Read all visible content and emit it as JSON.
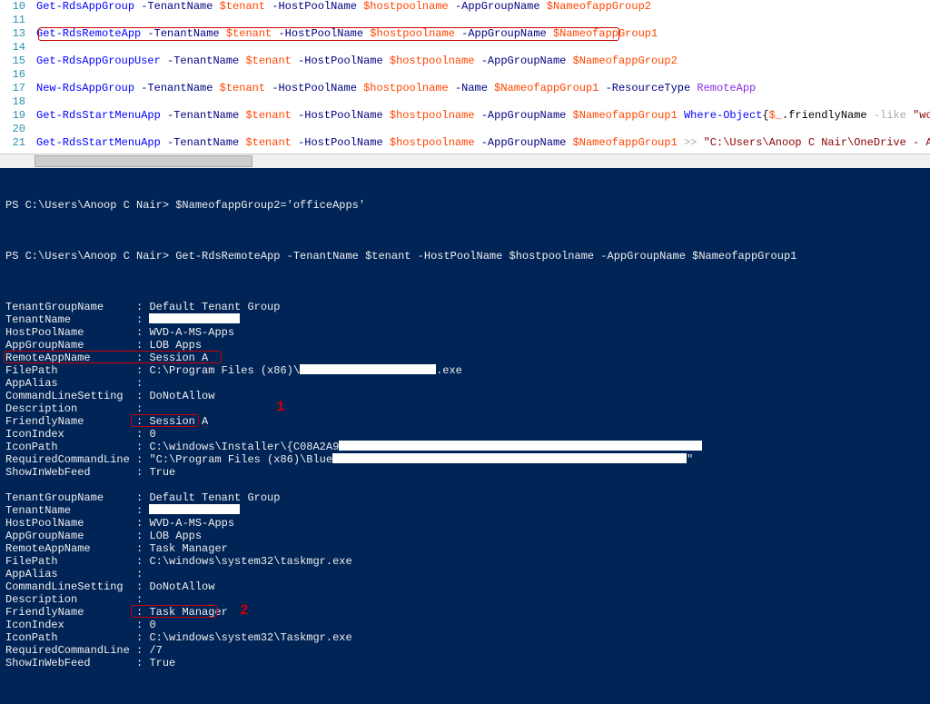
{
  "editor": {
    "lines": [
      {
        "n": 10,
        "tokens": [
          {
            "t": "Get-RdsAppGroup",
            "c": "t-cmd"
          },
          {
            "t": " ",
            "c": "t-plain"
          },
          {
            "t": "-TenantName",
            "c": "t-param"
          },
          {
            "t": " ",
            "c": "t-plain"
          },
          {
            "t": "$tenant",
            "c": "t-var"
          },
          {
            "t": " ",
            "c": "t-plain"
          },
          {
            "t": "-HostPoolName",
            "c": "t-param"
          },
          {
            "t": " ",
            "c": "t-plain"
          },
          {
            "t": "$hostpoolname",
            "c": "t-var"
          },
          {
            "t": " ",
            "c": "t-plain"
          },
          {
            "t": "-AppGroupName",
            "c": "t-param"
          },
          {
            "t": " ",
            "c": "t-plain"
          },
          {
            "t": "$NameofappGroup2",
            "c": "t-var"
          }
        ]
      },
      {
        "n": 11,
        "tokens": []
      },
      {
        "n": 13,
        "tokens": [
          {
            "t": "Get-RdsRemoteApp",
            "c": "t-cmd"
          },
          {
            "t": " ",
            "c": "t-plain"
          },
          {
            "t": "-TenantName",
            "c": "t-param"
          },
          {
            "t": " ",
            "c": "t-plain"
          },
          {
            "t": "$tenant",
            "c": "t-var"
          },
          {
            "t": " ",
            "c": "t-plain"
          },
          {
            "t": "-HostPoolName",
            "c": "t-param"
          },
          {
            "t": " ",
            "c": "t-plain"
          },
          {
            "t": "$hostpoolname",
            "c": "t-var"
          },
          {
            "t": " ",
            "c": "t-plain"
          },
          {
            "t": "-AppGroupName",
            "c": "t-param"
          },
          {
            "t": " ",
            "c": "t-plain"
          },
          {
            "t": "$NameofappGroup1",
            "c": "t-var"
          }
        ]
      },
      {
        "n": 14,
        "tokens": []
      },
      {
        "n": 15,
        "tokens": [
          {
            "t": "Get-RdsAppGroupUser",
            "c": "t-cmd"
          },
          {
            "t": " ",
            "c": "t-plain"
          },
          {
            "t": "-TenantName",
            "c": "t-param"
          },
          {
            "t": " ",
            "c": "t-plain"
          },
          {
            "t": "$tenant",
            "c": "t-var"
          },
          {
            "t": " ",
            "c": "t-plain"
          },
          {
            "t": "-HostPoolName",
            "c": "t-param"
          },
          {
            "t": " ",
            "c": "t-plain"
          },
          {
            "t": "$hostpoolname",
            "c": "t-var"
          },
          {
            "t": " ",
            "c": "t-plain"
          },
          {
            "t": "-AppGroupName",
            "c": "t-param"
          },
          {
            "t": " ",
            "c": "t-plain"
          },
          {
            "t": "$NameofappGroup2",
            "c": "t-var"
          }
        ]
      },
      {
        "n": 16,
        "tokens": []
      },
      {
        "n": 17,
        "tokens": [
          {
            "t": "New-RdsAppGroup",
            "c": "t-cmd"
          },
          {
            "t": " ",
            "c": "t-plain"
          },
          {
            "t": "-TenantName",
            "c": "t-param"
          },
          {
            "t": " ",
            "c": "t-plain"
          },
          {
            "t": "$tenant",
            "c": "t-var"
          },
          {
            "t": " ",
            "c": "t-plain"
          },
          {
            "t": "-HostPoolName",
            "c": "t-param"
          },
          {
            "t": " ",
            "c": "t-plain"
          },
          {
            "t": "$hostpoolname",
            "c": "t-var"
          },
          {
            "t": " ",
            "c": "t-plain"
          },
          {
            "t": "-Name",
            "c": "t-param"
          },
          {
            "t": " ",
            "c": "t-plain"
          },
          {
            "t": "$NameofappGroup1",
            "c": "t-var"
          },
          {
            "t": " ",
            "c": "t-plain"
          },
          {
            "t": "-ResourceType",
            "c": "t-param"
          },
          {
            "t": " ",
            "c": "t-plain"
          },
          {
            "t": "RemoteApp",
            "c": "t-type"
          }
        ]
      },
      {
        "n": 18,
        "tokens": []
      },
      {
        "n": 19,
        "tokens": [
          {
            "t": "Get-RdsStartMenuApp",
            "c": "t-cmd"
          },
          {
            "t": " ",
            "c": "t-plain"
          },
          {
            "t": "-TenantName",
            "c": "t-param"
          },
          {
            "t": " ",
            "c": "t-plain"
          },
          {
            "t": "$tenant",
            "c": "t-var"
          },
          {
            "t": " ",
            "c": "t-plain"
          },
          {
            "t": "-HostPoolName",
            "c": "t-param"
          },
          {
            "t": " ",
            "c": "t-plain"
          },
          {
            "t": "$hostpoolname",
            "c": "t-var"
          },
          {
            "t": " ",
            "c": "t-plain"
          },
          {
            "t": "-AppGroupName",
            "c": "t-param"
          },
          {
            "t": " ",
            "c": "t-plain"
          },
          {
            "t": "$NameofappGroup1",
            "c": "t-var"
          },
          {
            "t": " ",
            "c": "t-plain"
          },
          {
            "t": "Where-Object",
            "c": "t-pipe"
          },
          {
            "t": "{",
            "c": "t-plain"
          },
          {
            "t": "$_",
            "c": "t-var"
          },
          {
            "t": ".",
            "c": "t-plain"
          },
          {
            "t": "friendlyName",
            "c": "t-plain"
          },
          {
            "t": " ",
            "c": "t-plain"
          },
          {
            "t": "-like",
            "c": "t-op"
          },
          {
            "t": " ",
            "c": "t-plain"
          },
          {
            "t": "\"word\"",
            "c": "t-str"
          },
          {
            "t": "}",
            "c": "t-plain"
          }
        ]
      },
      {
        "n": 20,
        "tokens": []
      },
      {
        "n": 21,
        "tokens": [
          {
            "t": "Get-RdsStartMenuApp",
            "c": "t-cmd"
          },
          {
            "t": " ",
            "c": "t-plain"
          },
          {
            "t": "-TenantName",
            "c": "t-param"
          },
          {
            "t": " ",
            "c": "t-plain"
          },
          {
            "t": "$tenant",
            "c": "t-var"
          },
          {
            "t": " ",
            "c": "t-plain"
          },
          {
            "t": "-HostPoolName",
            "c": "t-param"
          },
          {
            "t": " ",
            "c": "t-plain"
          },
          {
            "t": "$hostpoolname",
            "c": "t-var"
          },
          {
            "t": " ",
            "c": "t-plain"
          },
          {
            "t": "-AppGroupName",
            "c": "t-param"
          },
          {
            "t": " ",
            "c": "t-plain"
          },
          {
            "t": "$NameofappGroup1",
            "c": "t-var"
          },
          {
            "t": " ",
            "c": "t-plain"
          },
          {
            "t": ">>",
            "c": "t-op"
          },
          {
            "t": " ",
            "c": "t-plain"
          },
          {
            "t": "\"C:\\Users\\Anoop C Nair\\OneDrive - ACN\\DW\\WVD -VDI\\",
            "c": "t-str"
          }
        ]
      }
    ]
  },
  "terminal": {
    "prompt_prefix": "PS C:\\Users\\Anoop C Nair> ",
    "cmd1": "$NameofappGroup2='officeApps'",
    "cmd2": "Get-RdsRemoteApp -TenantName $tenant -HostPoolName $hostpoolname -AppGroupName $NameofappGroup1",
    "blocks": [
      {
        "rows": [
          {
            "k": "TenantGroupName",
            "v": "Default Tenant Group"
          },
          {
            "k": "TenantName",
            "v": "",
            "redact_w": 100
          },
          {
            "k": "HostPoolName",
            "v": "WVD-A-MS-Apps"
          },
          {
            "k": "AppGroupName",
            "v": "LOB Apps"
          },
          {
            "k": "RemoteAppName",
            "v": "Session A"
          },
          {
            "k": "FilePath",
            "v": "C:\\Program Files (x86)\\",
            "redact_after": true,
            "redact_w": 150,
            "suffix": ".exe"
          },
          {
            "k": "AppAlias",
            "v": ""
          },
          {
            "k": "CommandLineSetting",
            "v": "DoNotAllow"
          },
          {
            "k": "Description",
            "v": ""
          },
          {
            "k": "FriendlyName",
            "v": "Session A"
          },
          {
            "k": "IconIndex",
            "v": "0"
          },
          {
            "k": "IconPath",
            "v": "C:\\windows\\Installer\\{C08A2A9",
            "redact_after": true,
            "redact_w": 400
          },
          {
            "k": "RequiredCommandLine",
            "v": "\"C:\\Program Files (x86)\\Blue",
            "redact_after": true,
            "redact_w": 390,
            "suffix": "\""
          },
          {
            "k": "ShowInWebFeed",
            "v": "True"
          }
        ],
        "highlight_rows": [
          4,
          9
        ],
        "anno": "1"
      },
      {
        "rows": [
          {
            "k": "TenantGroupName",
            "v": "Default Tenant Group"
          },
          {
            "k": "TenantName",
            "v": "",
            "redact_w": 100
          },
          {
            "k": "HostPoolName",
            "v": "WVD-A-MS-Apps"
          },
          {
            "k": "AppGroupName",
            "v": "LOB Apps"
          },
          {
            "k": "RemoteAppName",
            "v": "Task Manager"
          },
          {
            "k": "FilePath",
            "v": "C:\\windows\\system32\\taskmgr.exe"
          },
          {
            "k": "AppAlias",
            "v": ""
          },
          {
            "k": "CommandLineSetting",
            "v": "DoNotAllow"
          },
          {
            "k": "Description",
            "v": ""
          },
          {
            "k": "FriendlyName",
            "v": "Task Manager"
          },
          {
            "k": "IconIndex",
            "v": "0"
          },
          {
            "k": "IconPath",
            "v": "C:\\windows\\system32\\Taskmgr.exe"
          },
          {
            "k": "RequiredCommandLine",
            "v": "/7"
          },
          {
            "k": "ShowInWebFeed",
            "v": "True"
          }
        ],
        "highlight_rows": [
          9
        ],
        "anno": "2"
      }
    ],
    "key_width": 19
  }
}
